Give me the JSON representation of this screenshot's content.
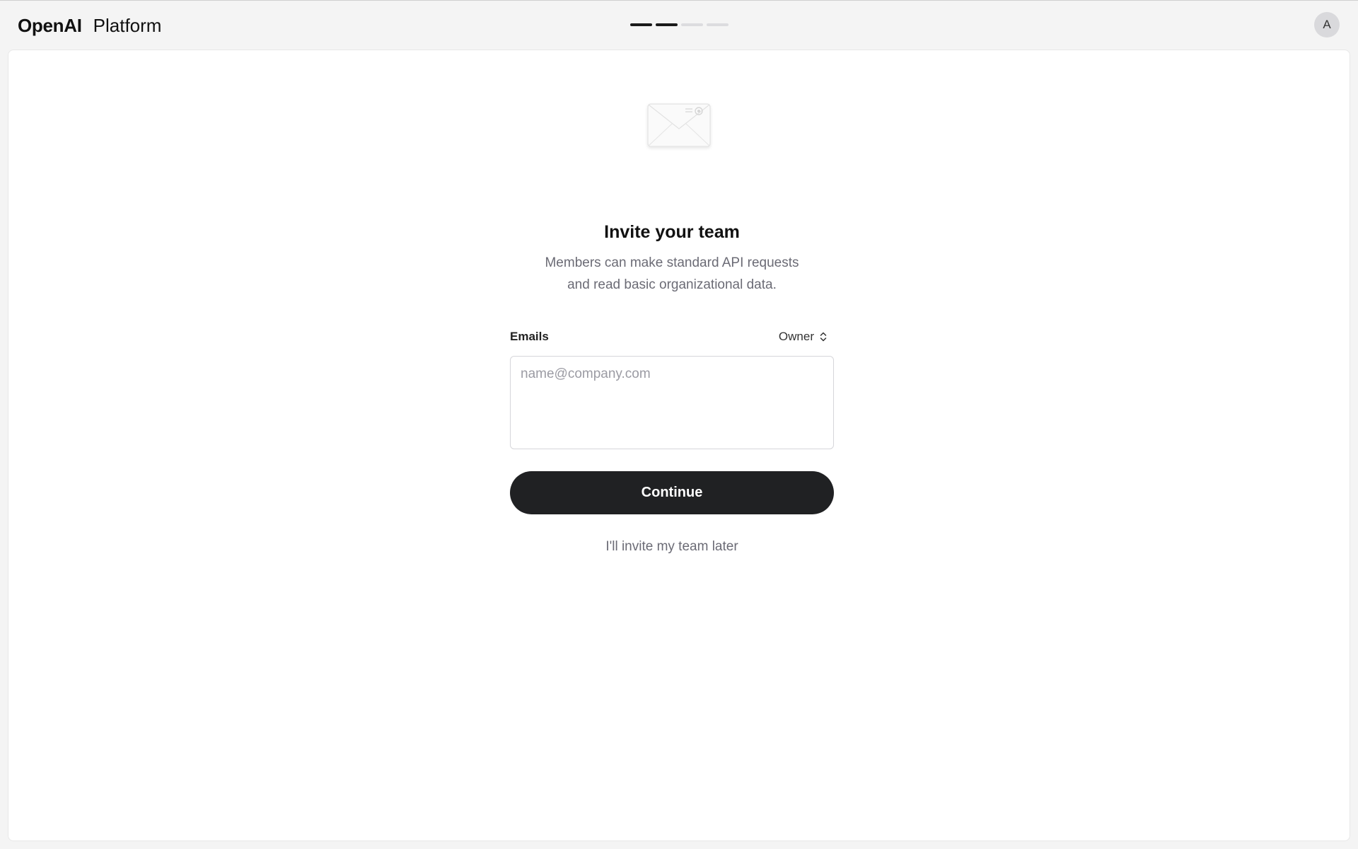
{
  "header": {
    "brand_name": "OpenAI",
    "product_name": "Platform",
    "progress": {
      "completed_steps": 2,
      "total_steps": 4
    },
    "avatar_initial": "A"
  },
  "invite": {
    "icon": "envelope-icon",
    "title": "Invite your team",
    "subtitle_line1": "Members can make standard API requests",
    "subtitle_line2": "and read basic organizational data.",
    "emails_label": "Emails",
    "role_value": "Owner",
    "emails_placeholder": "name@company.com",
    "emails_value": "",
    "continue_label": "Continue",
    "skip_label": "I'll invite my team later"
  },
  "colors": {
    "background": "#f4f4f4",
    "panel": "#ffffff",
    "button": "#202123",
    "muted_text": "#6b6b75",
    "progress_done": "#1a1a1a",
    "progress_todo": "#dcdcdf"
  }
}
